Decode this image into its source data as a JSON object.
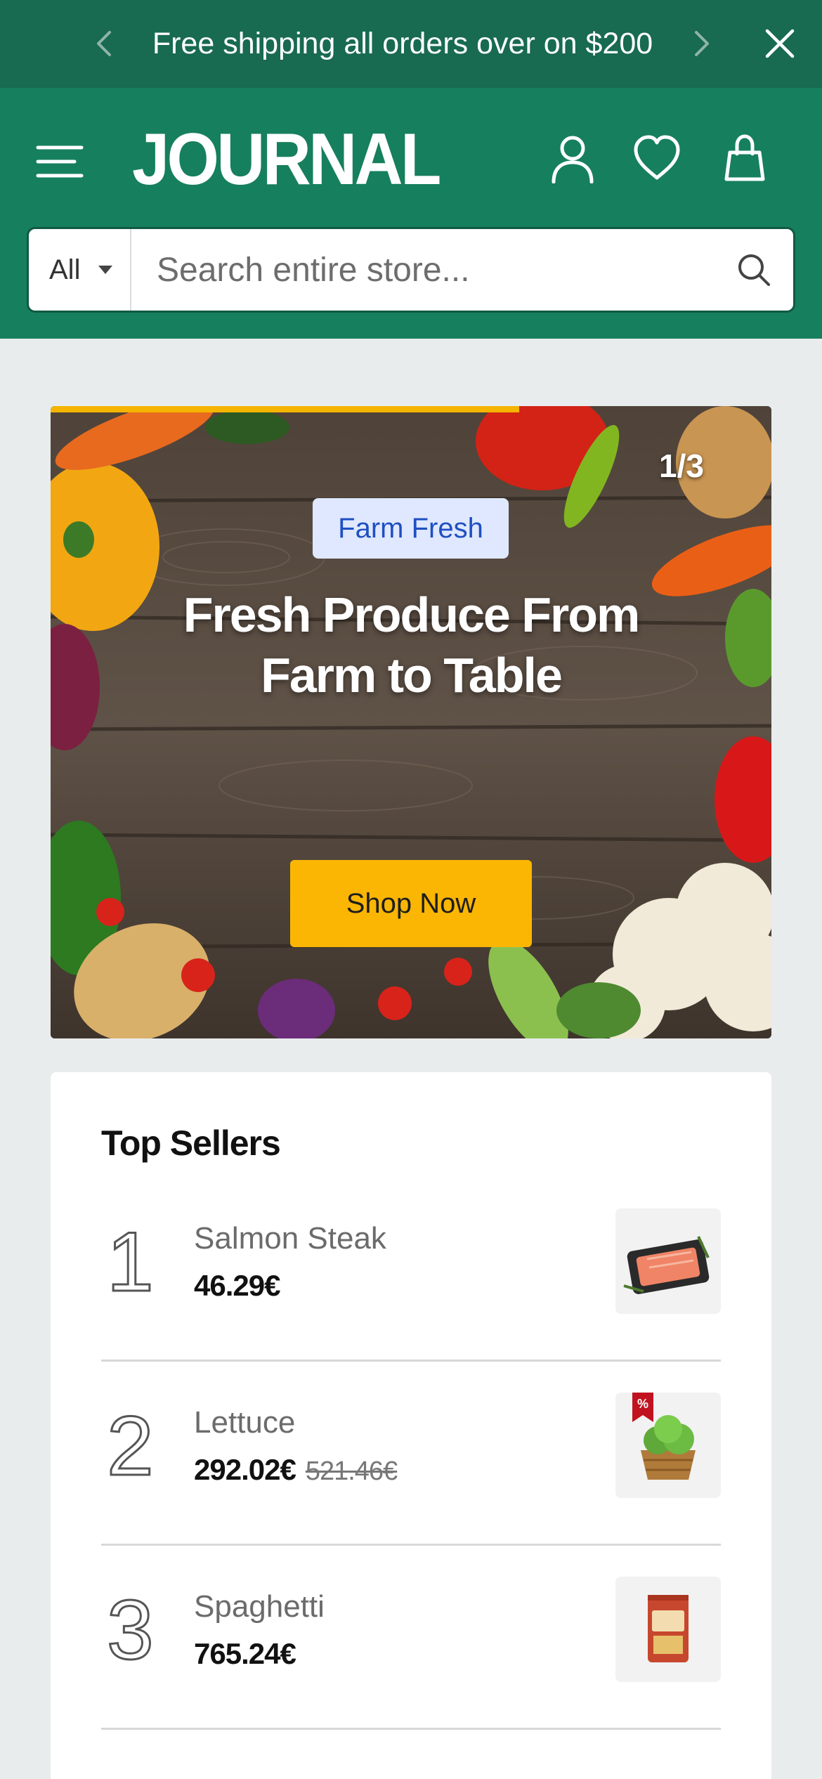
{
  "announcement": {
    "message": "Free shipping all orders over on $200",
    "prev_icon": "chevron-left-icon",
    "next_icon": "chevron-right-icon",
    "close_icon": "close-icon"
  },
  "header": {
    "logo_text": "JOURNAL",
    "menu_icon": "hamburger-icon",
    "account_icon": "user-icon",
    "wishlist_icon": "heart-icon",
    "cart_icon": "shopping-bag-icon"
  },
  "search": {
    "category": "All",
    "placeholder": "Search entire store...",
    "icon": "search-icon"
  },
  "hero": {
    "counter": "1/3",
    "badge": "Farm Fresh",
    "title": "Fresh Produce From Farm to Table",
    "button": "Shop Now",
    "slide_progress": 0.65
  },
  "top_sellers": {
    "title": "Top Sellers",
    "items": [
      {
        "rank": "1",
        "name": "Salmon Steak",
        "price": "46.29€",
        "old_price": ""
      },
      {
        "rank": "2",
        "name": "Lettuce",
        "price": "292.02€",
        "old_price": "521.46€",
        "sale_badge": "%"
      },
      {
        "rank": "3",
        "name": "Spaghetti",
        "price": "765.24€",
        "old_price": ""
      }
    ]
  },
  "colors": {
    "announce_bg": "#186a50",
    "header_bg": "#167f5e",
    "accent": "#fbb603",
    "badge_bg": "#dfe8ff"
  }
}
